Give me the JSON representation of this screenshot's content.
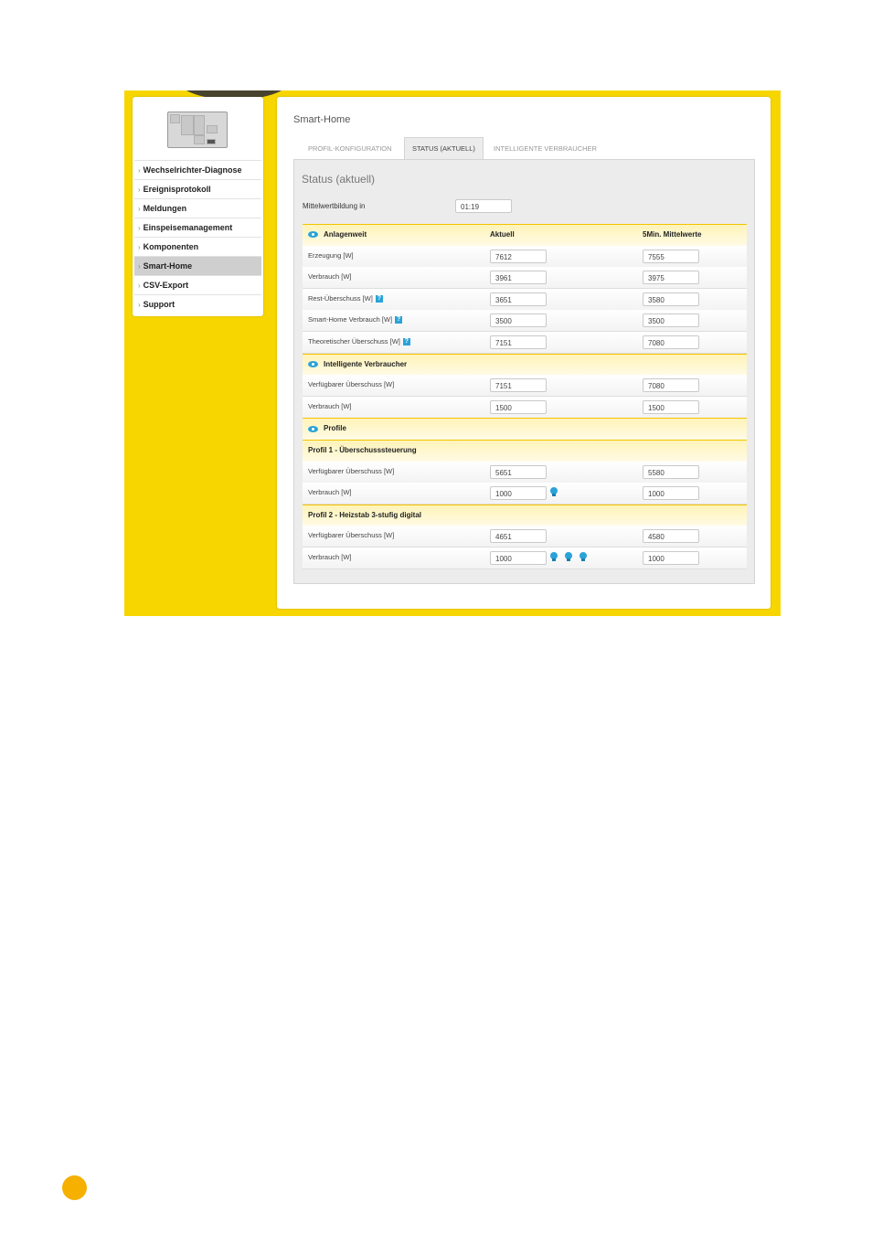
{
  "colors": {
    "brand_yellow": "#f7d600",
    "accent_blue": "#2aa3d8",
    "page_dot": "#f5b000"
  },
  "sidebar": {
    "items": [
      {
        "label": "Wechselrichter-Diagnose",
        "active": false
      },
      {
        "label": "Ereignisprotokoll",
        "active": false
      },
      {
        "label": "Meldungen",
        "active": false
      },
      {
        "label": "Einspeisemanagement",
        "active": false
      },
      {
        "label": "Komponenten",
        "active": false
      },
      {
        "label": "Smart-Home",
        "active": true
      },
      {
        "label": "CSV-Export",
        "active": false
      },
      {
        "label": "Support",
        "active": false
      }
    ],
    "arrow": "›"
  },
  "main": {
    "title": "Smart-Home",
    "tabs": [
      {
        "label": "PROFIL-KONFIGURATION",
        "active": false
      },
      {
        "label": "STATUS (AKTUELL)",
        "active": true
      },
      {
        "label": "INTELLIGENTE VERBRAUCHER",
        "active": false
      }
    ],
    "panel_title": "Status (aktuell)",
    "mittelwert_label": "Mittelwertbildung in",
    "mittelwert_value": "01:19",
    "help_glyph": "?",
    "sections": [
      {
        "header": "Anlagenweit",
        "eye": true,
        "col2": "Aktuell",
        "col3": "5Min. Mittelwerte",
        "rows": [
          {
            "label": "Erzeugung [W]",
            "aktuell": "7612",
            "mittel": "7555",
            "help": false
          },
          {
            "label": "Verbrauch [W]",
            "aktuell": "3961",
            "mittel": "3975",
            "help": false
          },
          {
            "label": "Rest-Überschuss [W]",
            "aktuell": "3651",
            "mittel": "3580",
            "help": true
          },
          {
            "label": "Smart-Home Verbrauch [W]",
            "aktuell": "3500",
            "mittel": "3500",
            "help": true
          },
          {
            "label": "Theoretischer Überschuss [W]",
            "aktuell": "7151",
            "mittel": "7080",
            "help": true
          }
        ]
      },
      {
        "header": "Intelligente Verbraucher",
        "eye": true,
        "rows": [
          {
            "label": "Verfügbarer Überschuss [W]",
            "aktuell": "7151",
            "mittel": "7080"
          },
          {
            "label": "Verbrauch [W]",
            "aktuell": "1500",
            "mittel": "1500"
          }
        ]
      },
      {
        "header": "Profile",
        "eye": true,
        "rows": []
      },
      {
        "header": "Profil 1 - Überschusssteuerung",
        "eye": false,
        "rows": [
          {
            "label": "Verfügbarer Überschuss [W]",
            "aktuell": "5651",
            "mittel": "5580",
            "bulbs": 0
          },
          {
            "label": "Verbrauch [W]",
            "aktuell": "1000",
            "mittel": "1000",
            "bulbs": 1
          }
        ]
      },
      {
        "header": "Profil 2 - Heizstab 3-stufig digital",
        "eye": false,
        "rows": [
          {
            "label": "Verfügbarer Überschuss [W]",
            "aktuell": "4651",
            "mittel": "4580",
            "bulbs": 0
          },
          {
            "label": "Verbrauch [W]",
            "aktuell": "1000",
            "mittel": "1000",
            "bulbs": 3
          }
        ]
      }
    ]
  }
}
